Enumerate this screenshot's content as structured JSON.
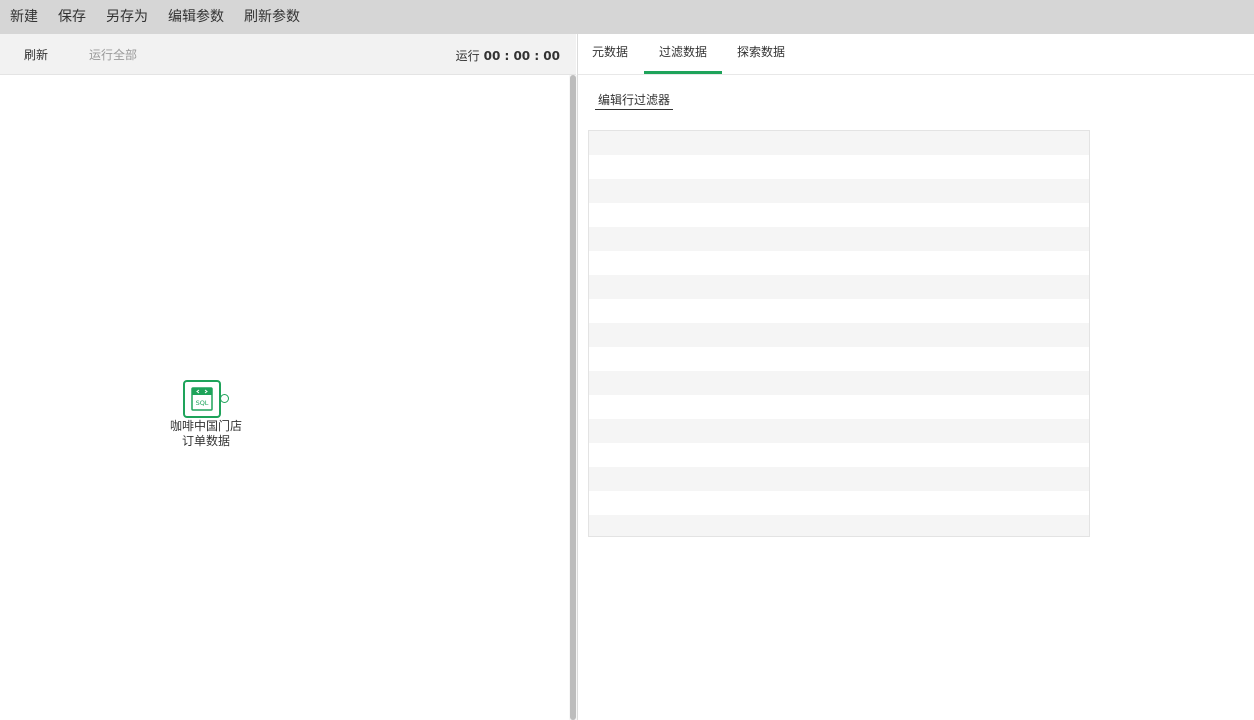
{
  "menubar": {
    "items": [
      "新建",
      "保存",
      "另存为",
      "编辑参数",
      "刷新参数"
    ]
  },
  "left_toolbar": {
    "refresh_label": "刷新",
    "run_all_label": "运行全部",
    "run_label": "运行",
    "run_time": "00 : 00 : 00"
  },
  "node": {
    "icon": "sql-icon",
    "icon_text": "SQL",
    "label_line1": "咖啡中国门店",
    "label_line2": "订单数据"
  },
  "right_panel": {
    "tabs": [
      {
        "label": "元数据",
        "active": false
      },
      {
        "label": "过滤数据",
        "active": true
      },
      {
        "label": "探索数据",
        "active": false
      }
    ],
    "edit_filter_label": "编辑行过滤器"
  },
  "colors": {
    "accent": "#1ea35a",
    "menubar_bg": "#d6d6d6",
    "toolbar_bg": "#f2f2f2",
    "grid_stripe": "#f5f5f5"
  }
}
